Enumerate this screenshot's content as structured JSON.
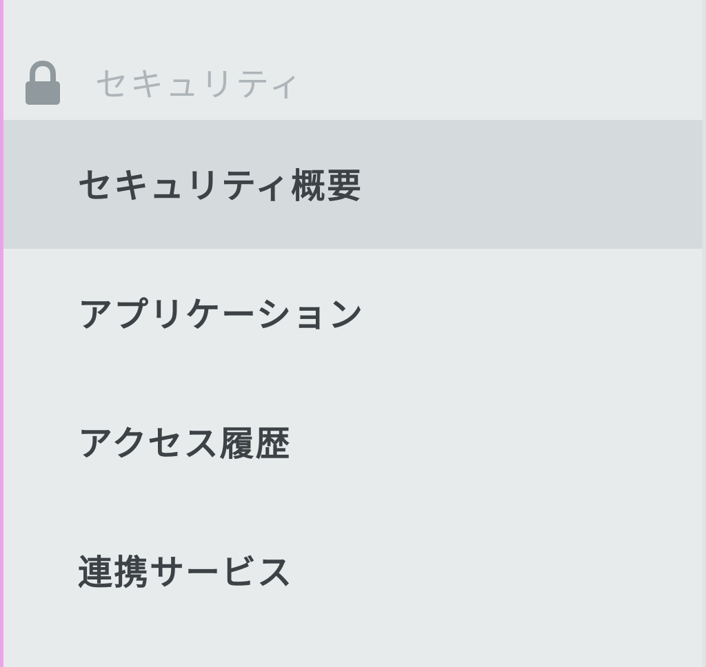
{
  "section": {
    "icon": "lock-icon",
    "title": "セキュリティ"
  },
  "nav": {
    "items": [
      {
        "label": "セキュリティ概要",
        "active": true
      },
      {
        "label": "アプリケーション",
        "active": false
      },
      {
        "label": "アクセス履歴",
        "active": false
      },
      {
        "label": "連携サービス",
        "active": false
      }
    ]
  },
  "colors": {
    "background": "#e8ebec",
    "active_background": "#d5dadc",
    "accent_border": "#e6a6e6",
    "header_text": "#aeb5b9",
    "item_text": "#3d4246"
  }
}
